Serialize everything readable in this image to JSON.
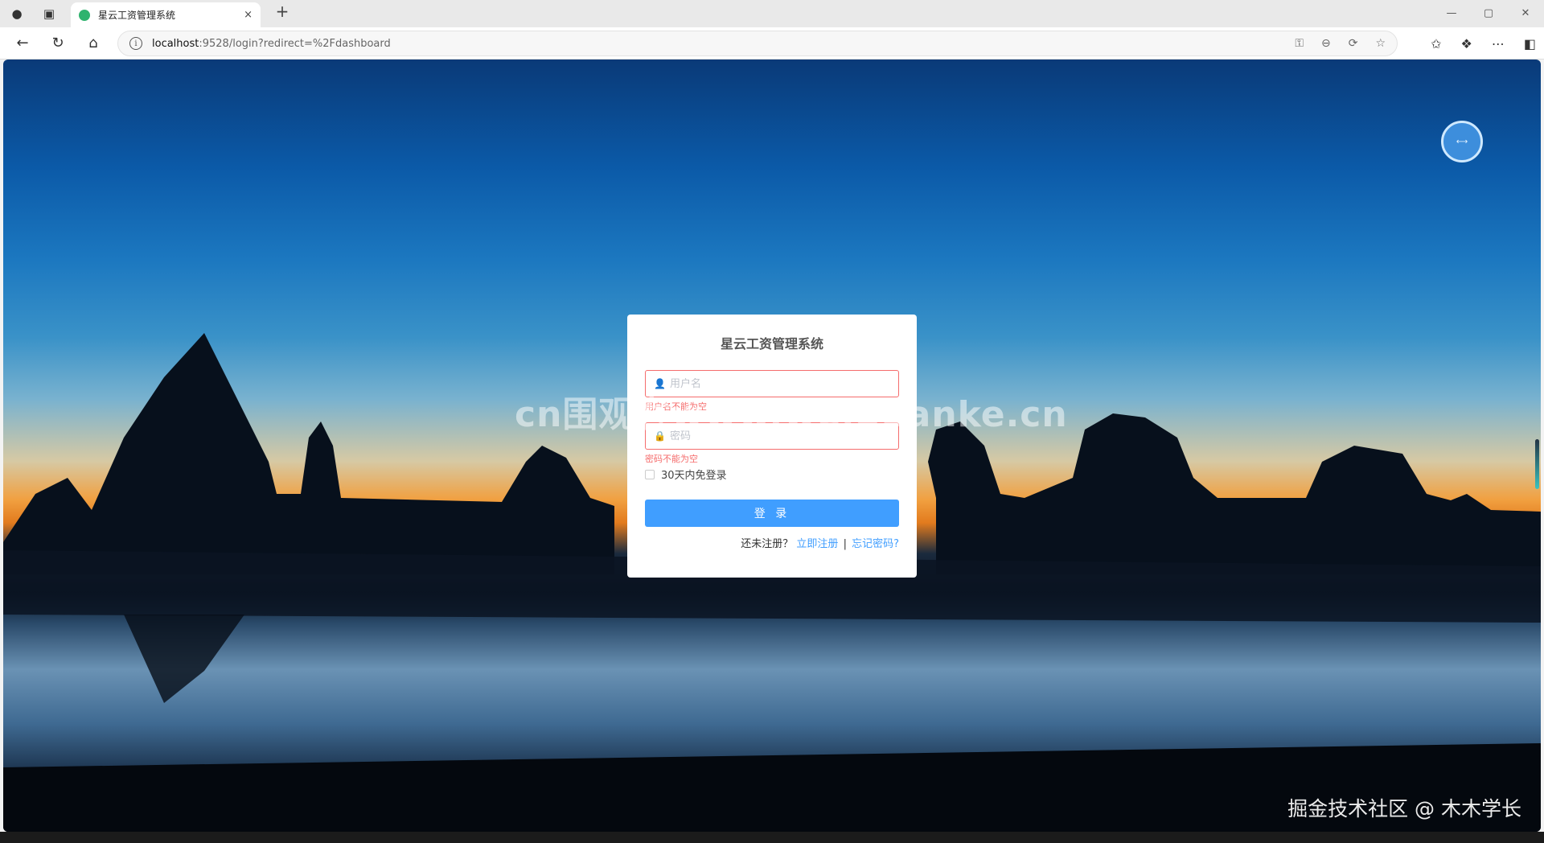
{
  "browser": {
    "tab_title": "星云工资管理系统",
    "tab_close": "×",
    "new_tab": "+",
    "url_host": "localhost",
    "url_path": ":9528/login?redirect=%2Fdashboard",
    "info_glyph": "i",
    "window_controls": [
      "—",
      "▢",
      "✕"
    ]
  },
  "page": {
    "watermark": "cn围观客www.weiguanke.cn",
    "credit": "掘金技术社区 @ 木木学长"
  },
  "login": {
    "title": "星云工资管理系统",
    "username_placeholder": "用户名",
    "username_error": "用户名不能为空",
    "password_placeholder": "密码",
    "password_error": "密码不能为空",
    "remember_label": "30天内免登录",
    "submit_label": "登 录",
    "not_registered": "还未注册？",
    "register_link": "立即注册",
    "separator": "|",
    "forgot_link": "忘记密码?"
  },
  "colors": {
    "primary": "#409eff",
    "error": "#f56c6c"
  }
}
